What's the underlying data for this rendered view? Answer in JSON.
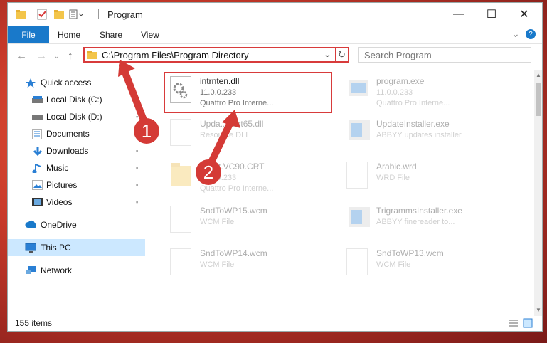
{
  "window": {
    "title": "Program",
    "controls": {
      "minimize": "—",
      "maximize": "☐",
      "close": "✕"
    }
  },
  "ribbon": {
    "tabs": [
      "File",
      "Home",
      "Share",
      "View"
    ],
    "chevron": "⌄",
    "help": "?"
  },
  "address": {
    "path": "C:\\Program Files\\Program Directory",
    "dropdown": "⌄",
    "refresh": "↻",
    "search_placeholder": "Search Program"
  },
  "nav": {
    "back": "←",
    "forward": "→",
    "recent": "⌄",
    "up": "↑"
  },
  "sidebar": {
    "items": [
      {
        "label": "Quick access",
        "icon": "star-icon",
        "pinned": false
      },
      {
        "label": "Local Disk (C:)",
        "icon": "drive-icon",
        "pinned": true
      },
      {
        "label": "Local Disk (D:)",
        "icon": "drive-icon",
        "pinned": true
      },
      {
        "label": "Documents",
        "icon": "documents-icon",
        "pinned": true
      },
      {
        "label": "Downloads",
        "icon": "download-icon",
        "pinned": true
      },
      {
        "label": "Music",
        "icon": "music-icon",
        "pinned": true
      },
      {
        "label": "Pictures",
        "icon": "pictures-icon",
        "pinned": true
      },
      {
        "label": "Videos",
        "icon": "videos-icon",
        "pinned": true
      },
      {
        "label": "OneDrive",
        "icon": "cloud-icon",
        "pinned": false
      },
      {
        "label": "This PC",
        "icon": "pc-icon",
        "pinned": false
      },
      {
        "label": "Network",
        "icon": "network-icon",
        "pinned": false
      }
    ],
    "pin_glyph": "📌"
  },
  "files": [
    {
      "name": "intrnten.dll",
      "line2": "11.0.0.233",
      "line3": "Quattro Pro Interne...",
      "icon": "dll-gear-icon",
      "highlighted": true
    },
    {
      "name": "program.exe",
      "line2": "11.0.0.233",
      "line3": "Quattro Pro Interne...",
      "icon": "exe-icon"
    },
    {
      "name": "Upda...lient65.dll",
      "line2": "Resource DLL",
      "line3": "",
      "icon": "dll-gear-icon"
    },
    {
      "name": "UpdateInstaller.exe",
      "line2": "ABBYY updates installer",
      "line3": "",
      "icon": "installer-icon"
    },
    {
      "name": "...soft.VC90.CRT",
      "line2": "11.0.0.233",
      "line3": "Quattro Pro Interne...",
      "icon": "folder-icon"
    },
    {
      "name": "Arabic.wrd",
      "line2": "WRD File",
      "line3": "",
      "icon": "file-icon"
    },
    {
      "name": "SndToWP15.wcm",
      "line2": "WCM File",
      "line3": "",
      "icon": "file-icon"
    },
    {
      "name": "TrigrammsInstaller.exe",
      "line2": "ABBYY finereader to...",
      "line3": "",
      "icon": "installer-icon"
    },
    {
      "name": "SndToWP14.wcm",
      "line2": "WCM File",
      "line3": "",
      "icon": "file-icon"
    },
    {
      "name": "SndToWP13.wcm",
      "line2": "WCM File",
      "line3": "",
      "icon": "file-icon"
    }
  ],
  "status": {
    "count": "155 items"
  },
  "callouts": [
    "1",
    "2"
  ],
  "colors": {
    "accent": "#1979ca",
    "highlight": "#d83b3b",
    "selected": "#cce8ff"
  }
}
